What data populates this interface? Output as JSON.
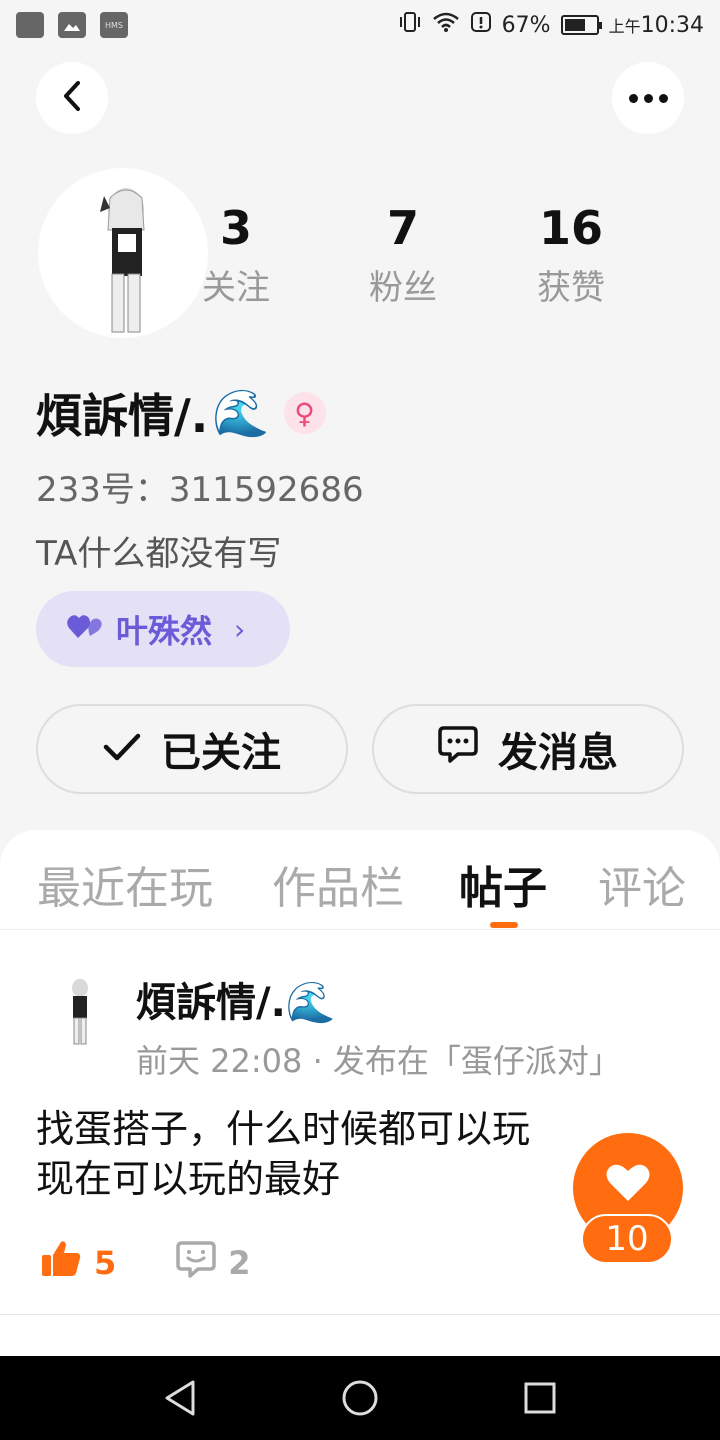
{
  "status_bar": {
    "notif_icons": [
      "app-icon",
      "gallery-icon",
      "hms-icon"
    ],
    "hms_label": "HMS",
    "battery": "67%",
    "battery_level": 0.67,
    "time_prefix": "上午",
    "time": "10:34"
  },
  "header": {
    "back_icon": "chevron-left-icon",
    "more_icon": "more-dots-icon"
  },
  "profile": {
    "username": "煩訴情/.",
    "username_emoji": "🌊",
    "gender_symbol": "♀",
    "uid": "233号：311592686",
    "bio": "TA什么都没有写",
    "stats": [
      {
        "value": "3",
        "label": "关注"
      },
      {
        "value": "7",
        "label": "粉丝"
      },
      {
        "value": "16",
        "label": "获赞"
      }
    ],
    "cp_tag": {
      "label": "叶殊然",
      "icon": "purple-heart-icon",
      "chevron": "›"
    }
  },
  "actions": {
    "follow_label": "已关注",
    "message_label": "发消息"
  },
  "tabs": [
    {
      "label": "最近在玩",
      "active": false
    },
    {
      "label": "作品栏",
      "active": false
    },
    {
      "label": "帖子",
      "active": true
    },
    {
      "label": "评论",
      "active": false
    }
  ],
  "post": {
    "author": "煩訴情/.",
    "author_emoji": "🌊",
    "meta": "前天 22:08 · 发布在「蛋仔派对」",
    "lines": [
      "找蛋搭子，什么时候都可以玩",
      "现在可以玩的最好"
    ],
    "likes": "5",
    "comments": "2"
  },
  "fab": {
    "count": "10",
    "icon": "heart-icon"
  },
  "colors": {
    "accent": "#ff6d10",
    "cp_bg": "#e4e0f6",
    "cp_text": "#6a5bd8",
    "background": "#f5f5f5"
  }
}
